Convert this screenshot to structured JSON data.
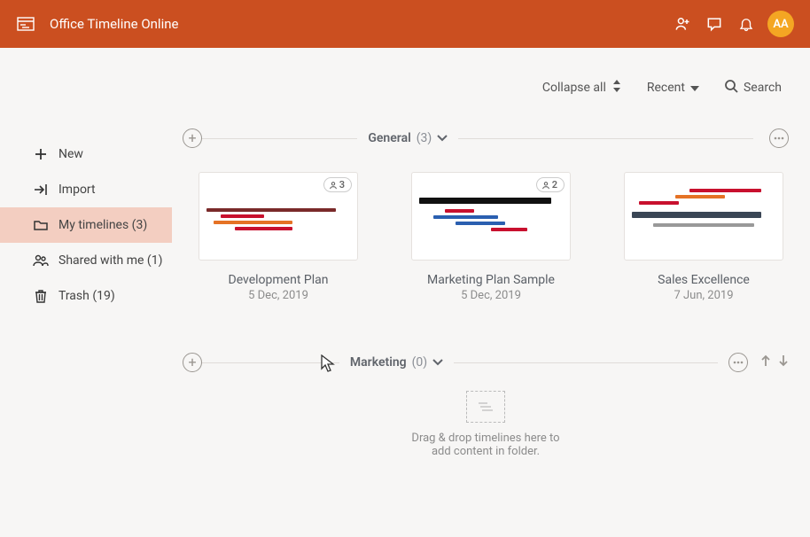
{
  "header": {
    "title": "Office Timeline Online",
    "avatar": "AA"
  },
  "sidebar": {
    "new": "New",
    "import": "Import",
    "my_timelines": "My timelines (3)",
    "shared": "Shared with me (1)",
    "trash": "Trash (19)"
  },
  "toolbar": {
    "collapse": "Collapse all",
    "sort": "Recent",
    "search": "Search"
  },
  "folders": {
    "general": {
      "name": "General",
      "count": "(3)"
    },
    "marketing": {
      "name": "Marketing",
      "count": "(0)"
    }
  },
  "cards": {
    "c0": {
      "title": "Development Plan",
      "date": "5 Dec, 2019",
      "share": "3"
    },
    "c1": {
      "title": "Marketing Plan Sample",
      "date": "5 Dec, 2019",
      "share": "2"
    },
    "c2": {
      "title": "Sales Excellence",
      "date": "7 Jun, 2019"
    }
  },
  "dropzone": {
    "line1": "Drag & drop timelines here to",
    "line2": "add content in folder."
  }
}
